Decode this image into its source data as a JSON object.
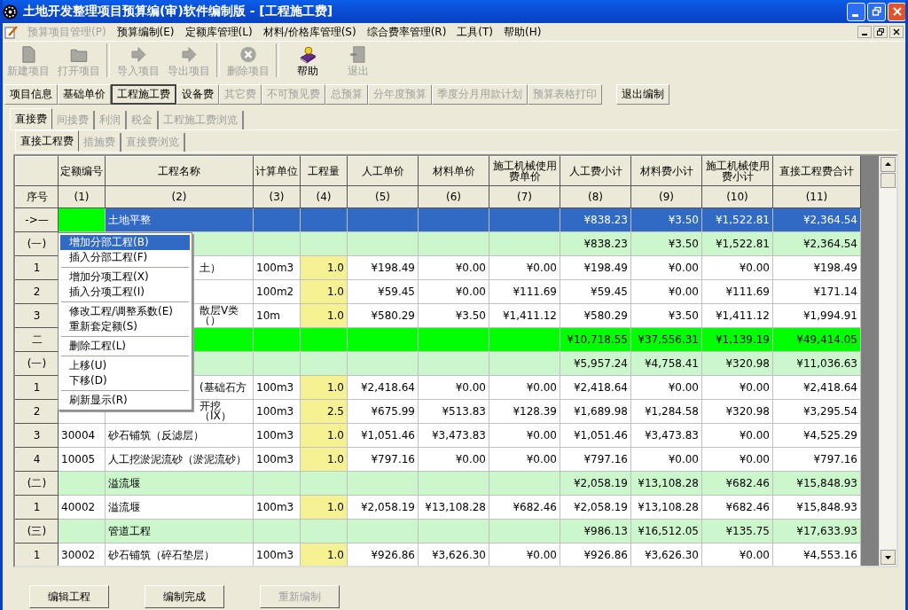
{
  "window": {
    "title": "土地开发整理项目预算编(审)软件编制版 - [工程施工费]"
  },
  "menu_bar": [
    {
      "label": "预算项目管理(P)",
      "disabled": true
    },
    {
      "label": "预算编制(E)",
      "disabled": false
    },
    {
      "label": "定额库管理(L)",
      "disabled": false
    },
    {
      "label": "材料/价格库管理(S)",
      "disabled": false
    },
    {
      "label": "综合费率管理(R)",
      "disabled": false
    },
    {
      "label": "工具(T)",
      "disabled": false
    },
    {
      "label": "帮助(H)",
      "disabled": false
    }
  ],
  "toolbar": [
    [
      {
        "label": "新建项目",
        "kind": "new",
        "disabled": true
      },
      {
        "label": "打开项目",
        "kind": "open",
        "disabled": true
      }
    ],
    [
      {
        "label": "导入项目",
        "kind": "import",
        "disabled": true
      },
      {
        "label": "导出项目",
        "kind": "export",
        "disabled": true
      }
    ],
    [
      {
        "label": "删除项目",
        "kind": "delete",
        "disabled": true
      }
    ],
    [
      {
        "label": "帮助",
        "kind": "help",
        "disabled": false
      },
      {
        "label": "退出",
        "kind": "exit",
        "disabled": true
      }
    ]
  ],
  "sections": [
    {
      "label": "项目信息",
      "disabled": false,
      "selected": false
    },
    {
      "label": "基础单价",
      "disabled": false,
      "selected": false
    },
    {
      "label": "工程施工费",
      "disabled": false,
      "selected": true
    },
    {
      "label": "设备费",
      "disabled": false,
      "selected": false
    },
    {
      "label": "其它费",
      "disabled": true,
      "selected": false
    },
    {
      "label": "不可预见费",
      "disabled": true,
      "selected": false
    },
    {
      "label": "总预算",
      "disabled": true,
      "selected": false
    },
    {
      "label": "分年度预算",
      "disabled": true,
      "selected": false
    },
    {
      "label": "季度分月用款计划",
      "disabled": true,
      "selected": false
    },
    {
      "label": "预算表格打印",
      "disabled": true,
      "selected": false
    }
  ],
  "exit_button": "退出编制",
  "tabs": [
    {
      "label": "直接费",
      "selected": true,
      "disabled": false
    },
    {
      "label": "间接费",
      "selected": false,
      "disabled": true
    },
    {
      "label": "利润",
      "selected": false,
      "disabled": true
    },
    {
      "label": "税金",
      "selected": false,
      "disabled": true
    },
    {
      "label": "工程施工费浏览",
      "selected": false,
      "disabled": true
    }
  ],
  "subtabs": [
    {
      "label": "直接工程费",
      "selected": true,
      "disabled": false
    },
    {
      "label": "措施费",
      "selected": false,
      "disabled": true
    },
    {
      "label": "直接费浏览",
      "selected": false,
      "disabled": true
    }
  ],
  "table": {
    "header_row_1": [
      "定额编号",
      "工程名称",
      "计算单位",
      "工程量",
      "人工单价",
      "材料单价",
      "施工机械使用费单价",
      "人工费小计",
      "材料费小计",
      "施工机械使用费小计",
      "直接工程费合计"
    ],
    "header_row_2": [
      "序号",
      "(1)",
      "(2)",
      "(3)",
      "(4)",
      "(5)",
      "(6)",
      "(7)",
      "(8)",
      "(9)",
      "(10)",
      "(11)"
    ],
    "rows": [
      {
        "seq": "->—",
        "kind": "section",
        "selected": true,
        "cells": [
          null,
          "土地平整",
          null,
          null,
          null,
          null,
          null,
          "¥838.23",
          "¥3.50",
          "¥1,522.81",
          "¥2,364.54"
        ]
      },
      {
        "seq": "(一)",
        "kind": "subsection",
        "selected": false,
        "cells": [
          null,
          null,
          null,
          null,
          null,
          null,
          null,
          "¥838.23",
          "¥3.50",
          "¥1,522.81",
          "¥2,364.54"
        ]
      },
      {
        "seq": "1",
        "kind": "item",
        "selected": false,
        "cells": [
          null,
          "土）",
          "100m3",
          "1.0",
          "¥198.49",
          "¥0.00",
          "¥0.00",
          "¥198.49",
          "¥0.00",
          "¥0.00",
          "¥198.49"
        ]
      },
      {
        "seq": "2",
        "kind": "item",
        "selected": false,
        "cells": [
          null,
          null,
          "100m2",
          "1.0",
          "¥59.45",
          "¥0.00",
          "¥111.69",
          "¥59.45",
          "¥0.00",
          "¥111.69",
          "¥171.14"
        ]
      },
      {
        "seq": "3",
        "kind": "item",
        "selected": false,
        "cells": [
          null,
          "散层Ⅴ类（）",
          "10m",
          "1.0",
          "¥580.29",
          "¥3.50",
          "¥1,411.12",
          "¥580.29",
          "¥3.50",
          "¥1,411.12",
          "¥1,994.91"
        ]
      },
      {
        "seq": "二",
        "kind": "section",
        "selected": false,
        "cells": [
          null,
          null,
          null,
          null,
          null,
          null,
          null,
          "¥10,718.55",
          "¥37,556.31",
          "¥1,139.19",
          "¥49,414.05"
        ]
      },
      {
        "seq": "(一)",
        "kind": "subsection",
        "selected": false,
        "cells": [
          null,
          null,
          null,
          null,
          null,
          null,
          null,
          "¥5,957.24",
          "¥4,758.41",
          "¥320.98",
          "¥11,036.63"
        ]
      },
      {
        "seq": "1",
        "kind": "item",
        "selected": false,
        "cells": [
          null,
          "(基础石方",
          "100m3",
          "1.0",
          "¥2,418.64",
          "¥0.00",
          "¥0.00",
          "¥2,418.64",
          "¥0.00",
          "¥0.00",
          "¥2,418.64"
        ]
      },
      {
        "seq": "2",
        "kind": "item",
        "selected": false,
        "cells": [
          null,
          "开挖（IX）",
          "100m3",
          "2.5",
          "¥675.99",
          "¥513.83",
          "¥128.39",
          "¥1,689.98",
          "¥1,284.58",
          "¥320.98",
          "¥3,295.54"
        ]
      },
      {
        "seq": "3",
        "kind": "item",
        "selected": false,
        "cells": [
          "30004",
          "砂石铺筑（反滤层）",
          "100m3",
          "1.0",
          "¥1,051.46",
          "¥3,473.83",
          "¥0.00",
          "¥1,051.46",
          "¥3,473.83",
          "¥0.00",
          "¥4,525.29"
        ]
      },
      {
        "seq": "4",
        "kind": "item",
        "selected": false,
        "cells": [
          "10005",
          "人工挖淤泥流砂（淤泥流砂）",
          "100m3",
          "1.0",
          "¥797.16",
          "¥0.00",
          "¥0.00",
          "¥797.16",
          "¥0.00",
          "¥0.00",
          "¥797.16"
        ]
      },
      {
        "seq": "(二)",
        "kind": "subsection",
        "selected": false,
        "cells": [
          null,
          "溢流堰",
          null,
          null,
          null,
          null,
          null,
          "¥2,058.19",
          "¥13,108.28",
          "¥682.46",
          "¥15,848.93"
        ]
      },
      {
        "seq": "1",
        "kind": "item",
        "selected": false,
        "cells": [
          "40002",
          "溢流堰",
          "100m3",
          "1.0",
          "¥2,058.19",
          "¥13,108.28",
          "¥682.46",
          "¥2,058.19",
          "¥13,108.28",
          "¥682.46",
          "¥15,848.93"
        ]
      },
      {
        "seq": "(三)",
        "kind": "subsection",
        "selected": false,
        "cells": [
          null,
          "管道工程",
          null,
          null,
          null,
          null,
          null,
          "¥986.13",
          "¥16,512.05",
          "¥135.75",
          "¥17,633.93"
        ]
      },
      {
        "seq": "1",
        "kind": "item",
        "selected": false,
        "cells": [
          "30002",
          "砂石铺筑（碎石垫层）",
          "100m3",
          "1.0",
          "¥926.86",
          "¥3,626.30",
          "¥0.00",
          "¥926.86",
          "¥3,626.30",
          "¥0.00",
          "¥4,553.16"
        ]
      }
    ]
  },
  "context_menu": {
    "groups": [
      [
        {
          "label": "增加分部工程(B)",
          "selected": true
        },
        {
          "label": "插入分部工程(F)",
          "selected": false
        }
      ],
      [
        {
          "label": "增加分项工程(X)",
          "selected": false
        },
        {
          "label": "插入分项工程(I)",
          "selected": false
        }
      ],
      [
        {
          "label": "修改工程/调整系数(E)",
          "selected": false
        },
        {
          "label": "重新套定额(S)",
          "selected": false
        }
      ],
      [
        {
          "label": "删除工程(L)",
          "selected": false
        }
      ],
      [
        {
          "label": "上移(U)",
          "selected": false
        },
        {
          "label": "下移(D)",
          "selected": false
        }
      ],
      [
        {
          "label": "刷新显示(R)",
          "selected": false
        }
      ]
    ]
  },
  "bottom_buttons": [
    {
      "label": "编辑工程",
      "disabled": false
    },
    {
      "label": "编制完成",
      "disabled": false
    },
    {
      "label": "重新编制",
      "disabled": true
    }
  ]
}
